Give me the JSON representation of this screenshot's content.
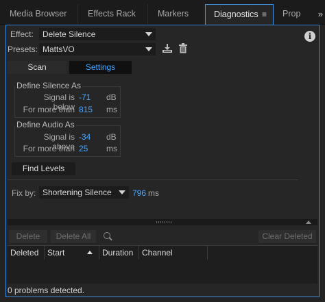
{
  "tabs": [
    {
      "label": "Media Browser"
    },
    {
      "label": "Effects Rack"
    },
    {
      "label": "Markers"
    },
    {
      "label": "Diagnostics",
      "menu_glyph": "≡"
    },
    {
      "label": "Prop"
    }
  ],
  "overflow_glyph": "»",
  "effect": {
    "label": "Effect:",
    "value": "Delete Silence"
  },
  "presets": {
    "label": "Presets:",
    "value": "MattsVO"
  },
  "info_glyph": "i",
  "subtabs": {
    "scan": "Scan",
    "settings": "Settings"
  },
  "silence": {
    "title": "Define Silence As",
    "signal_label": "Signal is below",
    "signal_value": "-71",
    "signal_unit": "dB",
    "duration_label": "For more than",
    "duration_value": "815",
    "duration_unit": "ms"
  },
  "audio": {
    "title": "Define Audio As",
    "signal_label": "Signal is above",
    "signal_value": "-34",
    "signal_unit": "dB",
    "duration_label": "For more than",
    "duration_value": "25",
    "duration_unit": "ms"
  },
  "find_levels": "Find Levels",
  "fix": {
    "label": "Fix by:",
    "value": "Shortening Silence",
    "amount": "796",
    "unit": "ms"
  },
  "actions": {
    "delete": "Delete",
    "delete_all": "Delete All",
    "clear_deleted": "Clear Deleted"
  },
  "columns": [
    "Deleted",
    "Start",
    "Duration",
    "Channel"
  ],
  "status": "0 problems detected."
}
